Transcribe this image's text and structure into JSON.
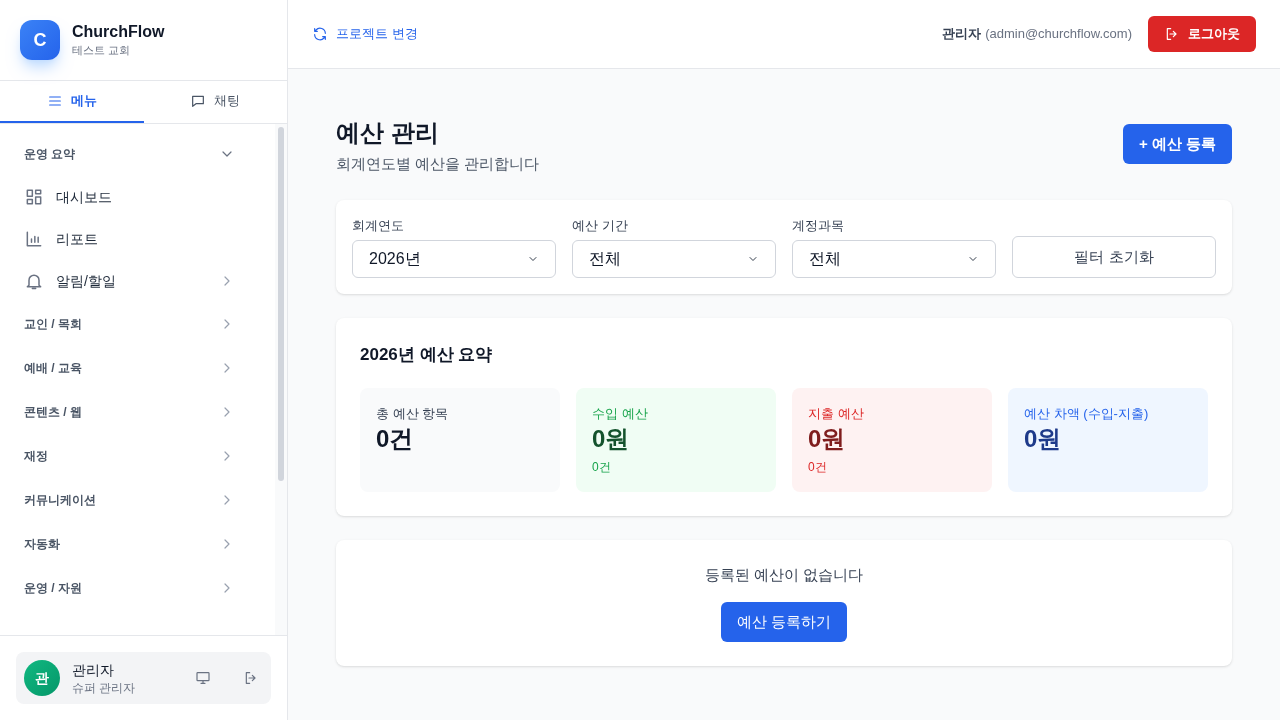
{
  "brand": {
    "logo": "C",
    "name": "ChurchFlow",
    "church": "테스트 교회"
  },
  "sidebar_tabs": [
    {
      "label": "메뉴",
      "selected": true
    },
    {
      "label": "채팅",
      "selected": false
    }
  ],
  "menu": [
    {
      "kind": "section",
      "label": "운영 요약",
      "expanded": true,
      "children": [
        {
          "label": "대시보드",
          "has_submenu": false
        },
        {
          "label": "리포트",
          "has_submenu": false
        },
        {
          "label": "알림/할일",
          "has_submenu": true
        }
      ]
    },
    {
      "kind": "section",
      "label": "교인 / 목회",
      "expanded": false
    },
    {
      "kind": "section",
      "label": "예배 / 교육",
      "expanded": false
    },
    {
      "kind": "section",
      "label": "콘텐츠 / 웹",
      "expanded": false
    },
    {
      "kind": "section",
      "label": "재정",
      "expanded": false
    },
    {
      "kind": "section",
      "label": "커뮤니케이션",
      "expanded": false
    },
    {
      "kind": "section",
      "label": "자동화",
      "expanded": false
    },
    {
      "kind": "section",
      "label": "운영 / 자원",
      "expanded": false
    }
  ],
  "user": {
    "avatar": "관",
    "name": "관리자",
    "role": "슈퍼 관리자"
  },
  "topbar": {
    "switch_project": "프로젝트 변경",
    "user_name": "관리자",
    "user_email": "(admin@churchflow.com)",
    "logout": "로그아웃"
  },
  "page": {
    "title": "예산 관리",
    "subtitle": "회계연도별 예산을 관리합니다",
    "add_button": "+ 예산 등록"
  },
  "filters": [
    {
      "label": "회계연도",
      "value": "2026년"
    },
    {
      "label": "예산 기간",
      "value": "전체"
    },
    {
      "label": "계정과목",
      "value": "전체"
    }
  ],
  "reset_button": "필터 초기화",
  "summary": {
    "title": "2026년 예산 요약",
    "cards": [
      {
        "label": "총 예산 항목",
        "value": "0건"
      },
      {
        "label": "수입 예산",
        "value": "0원",
        "count": "0건"
      },
      {
        "label": "지출 예산",
        "value": "0원",
        "count": "0건"
      },
      {
        "label": "예산 차액 (수입-지출)",
        "value": "0원"
      }
    ]
  },
  "empty": {
    "message": "등록된 예산이 없습니다",
    "button": "예산 등록하기"
  }
}
